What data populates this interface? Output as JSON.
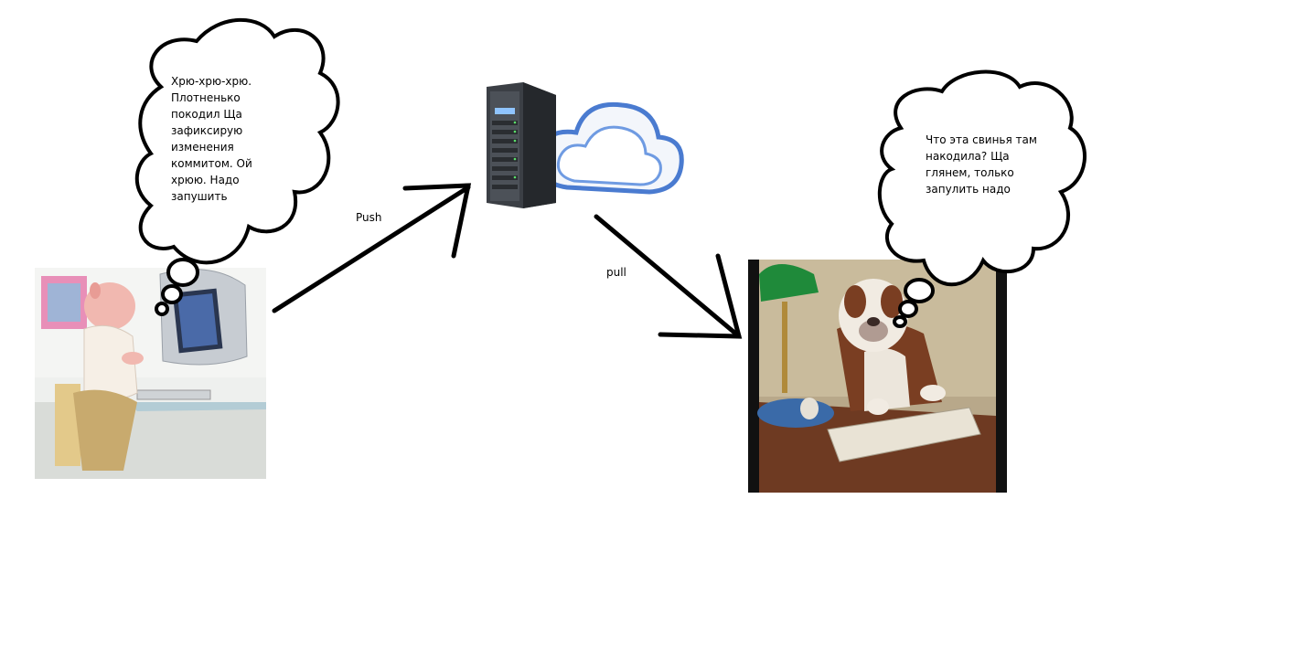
{
  "pig_thought": {
    "lines": [
      "Хрю-хрю-хрю.",
      "Плотненько",
      "покодил Ща",
      "зафиксирую",
      "изменения",
      "коммитом. Ой",
      "хрюю. Надо",
      "запушить"
    ]
  },
  "dog_thought": {
    "lines": [
      "Что эта свинья там",
      "накодила? Ща",
      "глянем, только",
      "запулить надо"
    ]
  },
  "edges": {
    "push_label": "Push",
    "pull_label": "pull"
  }
}
